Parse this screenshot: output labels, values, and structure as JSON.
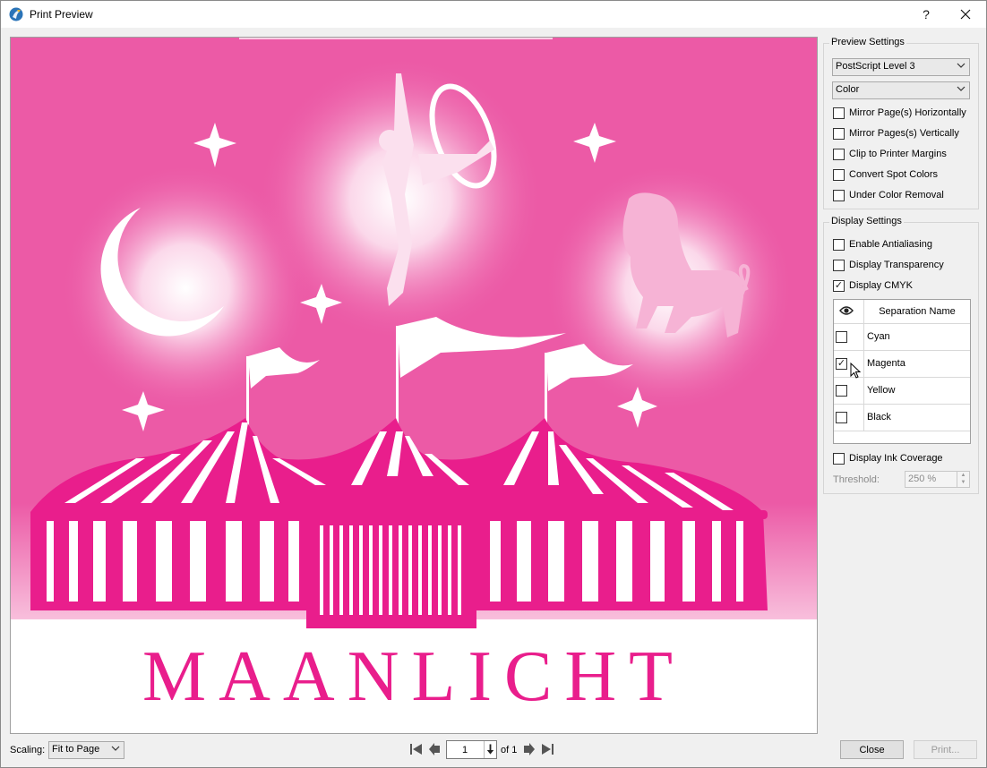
{
  "window": {
    "title": "Print Preview",
    "help_glyph": "?",
    "close_glyph": "✕"
  },
  "preview": {
    "artwork_title": "MAANLICHT",
    "accent_color": "#e91e8c",
    "background_color": "#ec5aa6"
  },
  "preview_settings": {
    "group_title": "Preview Settings",
    "postscript_level": "PostScript Level 3",
    "color_mode": "Color",
    "options": [
      {
        "label": "Mirror Page(s) Horizontally",
        "checked": false
      },
      {
        "label": "Mirror Pages(s) Vertically",
        "checked": false
      },
      {
        "label": "Clip to Printer Margins",
        "checked": false
      },
      {
        "label": "Convert Spot Colors",
        "checked": false
      },
      {
        "label": "Under Color Removal",
        "checked": false
      }
    ]
  },
  "display_settings": {
    "group_title": "Display Settings",
    "options": [
      {
        "label": "Enable Antialiasing",
        "checked": false
      },
      {
        "label": "Display Transparency",
        "checked": false
      },
      {
        "label": "Display CMYK",
        "checked": true
      }
    ],
    "separations": {
      "header_icon": "eye-icon",
      "header_label": "Separation Name",
      "rows": [
        {
          "name": "Cyan",
          "checked": false
        },
        {
          "name": "Magenta",
          "checked": true
        },
        {
          "name": "Yellow",
          "checked": false
        },
        {
          "name": "Black",
          "checked": false
        }
      ]
    },
    "ink_coverage": {
      "label": "Display Ink Coverage",
      "checked": false
    },
    "threshold_label": "Threshold:",
    "threshold_value": "250 %"
  },
  "bottom": {
    "scaling_label": "Scaling:",
    "scaling_value": "Fit to Page",
    "page_value": "1",
    "page_of": "of 1",
    "close_label": "Close",
    "print_label": "Print..."
  }
}
